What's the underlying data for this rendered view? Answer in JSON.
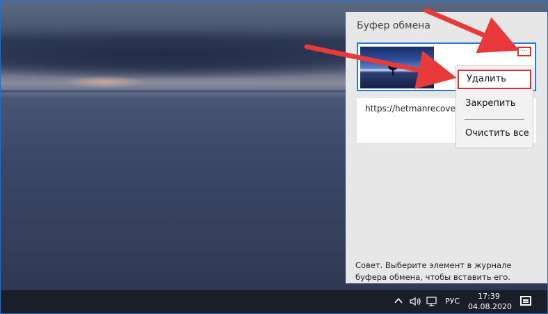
{
  "clipboard": {
    "title": "Буфер обмена",
    "more_button": "···",
    "text_item": "https://hetmanrecovery.c",
    "tip": "Совет. Выберите элемент в журнале буфера обмена, чтобы вставить его."
  },
  "context_menu": {
    "delete": "Удалить",
    "pin": "Закрепить",
    "clear_all": "Очистить все"
  },
  "taskbar": {
    "language": "РУС",
    "time": "17:39",
    "date": "04.08.2020",
    "icons": [
      "chevron-up-icon",
      "speaker-icon",
      "network-icon",
      "notification-icon"
    ]
  },
  "colors": {
    "accent": "#2b78d2",
    "highlight_red": "#e02c2c",
    "taskbar": "#1a1e29",
    "panel": "#e7e7e7"
  }
}
